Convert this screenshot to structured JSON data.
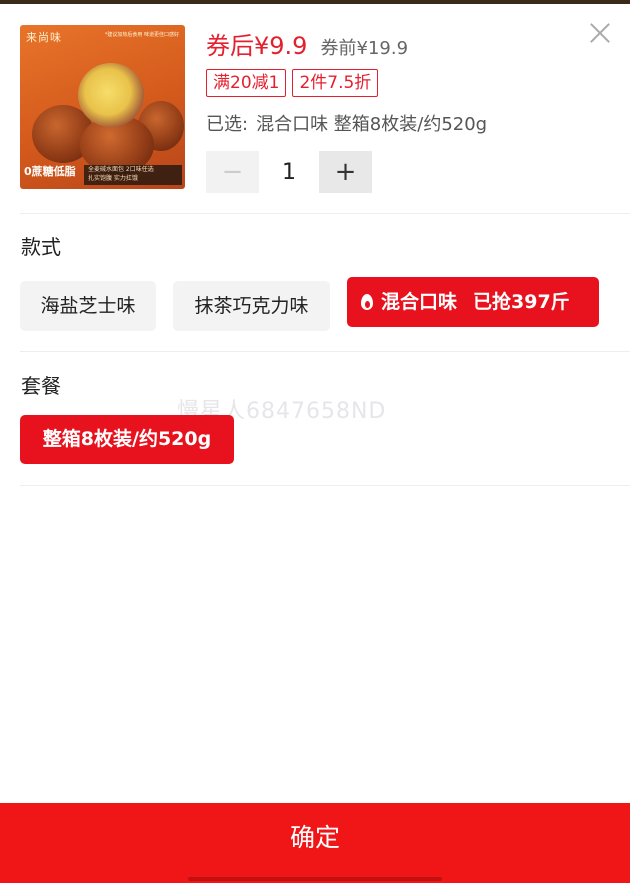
{
  "product": {
    "image": {
      "brand_text": "来尚味",
      "tip_text": "*建议加热后食用 味道更佳口感好",
      "side_text": "0蔗糖低脂",
      "band_line1": "全麦碱水面包 2口味任选",
      "band_line2": "扎实饱腹 实力扛饿"
    },
    "price_after_coupon": "券后¥9.9",
    "price_before_coupon": "券前¥19.9",
    "promo_tags": [
      "满20减1",
      "2件7.5折"
    ],
    "selected_label": "已选:",
    "selected_value": "混合口味 整箱8枚装/约520g"
  },
  "quantity": {
    "value": "1",
    "minus_symbol": "−",
    "plus_symbol": "+"
  },
  "style_section": {
    "title": "款式",
    "options": [
      {
        "label": "海盐芝士味"
      },
      {
        "label": "抹茶巧克力味"
      },
      {
        "label": "混合口味",
        "badge": "已抢397斤"
      }
    ]
  },
  "package_section": {
    "title": "套餐",
    "options": [
      {
        "label": "整箱8枚装/约520g"
      }
    ]
  },
  "watermark": "慢星人6847658ND",
  "confirm_label": "确定",
  "colors": {
    "accent_red": "#e8121e",
    "button_red": "#f01617",
    "price_red": "#e5202e"
  }
}
